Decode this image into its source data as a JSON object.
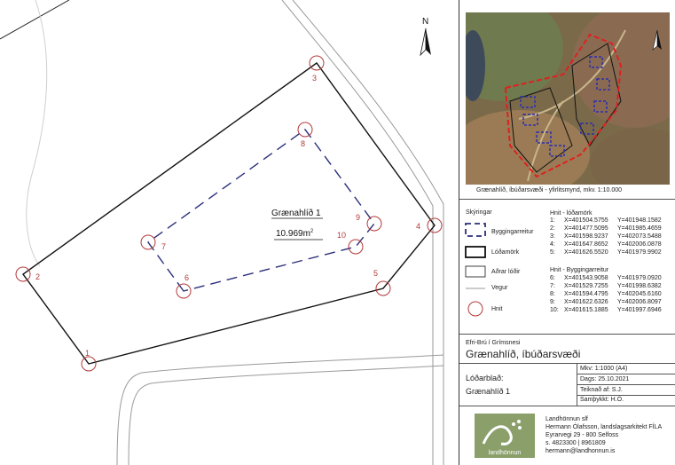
{
  "map": {
    "parcel_name": "Grænahlíð 1",
    "parcel_area": "10.969m",
    "parcel_area_sup": "2",
    "north_label": "N",
    "points": [
      {
        "id": "1",
        "label": "1"
      },
      {
        "id": "2",
        "label": "2"
      },
      {
        "id": "3",
        "label": "3"
      },
      {
        "id": "4",
        "label": "4"
      },
      {
        "id": "5",
        "label": "5"
      },
      {
        "id": "6",
        "label": "6"
      },
      {
        "id": "7",
        "label": "7"
      },
      {
        "id": "8",
        "label": "8"
      },
      {
        "id": "9",
        "label": "9"
      },
      {
        "id": "10",
        "label": "10"
      }
    ]
  },
  "overview": {
    "caption": "Grænahlíð, íbúðarsvæði - yfirlitsmynd, mkv. 1:10.000"
  },
  "legend": {
    "title": "Skýringar",
    "items": [
      {
        "name": "building-area",
        "label": "Byggingarreitur"
      },
      {
        "name": "parcel",
        "label": "Lóðamörk"
      },
      {
        "name": "other-parcels",
        "label": "Aðrar lóðir"
      },
      {
        "name": "road",
        "label": "Vegur"
      },
      {
        "name": "points",
        "label": "Hnit"
      }
    ]
  },
  "coords_parcel": {
    "title": "Hnit - lóðamörk",
    "rows": [
      {
        "n": "1:",
        "x": "X=401504.5755",
        "y": "Y=401948.1582"
      },
      {
        "n": "2:",
        "x": "X=401477.5095",
        "y": "Y=401985.4659"
      },
      {
        "n": "3:",
        "x": "X=401598.9237",
        "y": "Y=402073.5488"
      },
      {
        "n": "4:",
        "x": "X=401647.8652",
        "y": "Y=402006.0878"
      },
      {
        "n": "5:",
        "x": "X=401626.5520",
        "y": "Y=401979.9902"
      }
    ]
  },
  "coords_building": {
    "title": "Hnit - Byggingarreitur",
    "rows": [
      {
        "n": "6:",
        "x": "X=401543.9058",
        "y": "Y=401979.0920"
      },
      {
        "n": "7:",
        "x": "X=401529.7255",
        "y": "Y=401998.6382"
      },
      {
        "n": "8:",
        "x": "X=401594.4795",
        "y": "Y=402045.6160"
      },
      {
        "n": "9:",
        "x": "X=401622.6326",
        "y": "Y=402006.8097"
      },
      {
        "n": "10:",
        "x": "X=401615.1885",
        "y": "Y=401997.6946"
      }
    ]
  },
  "project": {
    "location": "Efri-Brú í Grímsnesi",
    "name": "Grænahlíð, íbúðarsvæði",
    "sheet_label": "Lóðarblað:",
    "sheet_value": "Grænahlíð 1",
    "scale": "Mkv: 1:1000 (A4)",
    "date": "Dags: 25.10.2021",
    "drawn": "Teiknað af: S.J.",
    "approved": "Samþykkt: H.Ó."
  },
  "company": {
    "logo_text": "landhönnun",
    "lines": [
      "Landhönnun slf",
      "Hermann Ólafsson, landslagsarkitekt FÍLA",
      "Eyrarvegi 29 - 800 Selfoss",
      "s. 4823300 | 8961809",
      "hermann@landhonnun.is"
    ]
  },
  "colors": {
    "building_dash": "#2b2f7a",
    "point_circle": "#b23a3a",
    "point_label": "#b23a3a",
    "road": "#999999",
    "logo_bg": "#8a9f6a"
  }
}
